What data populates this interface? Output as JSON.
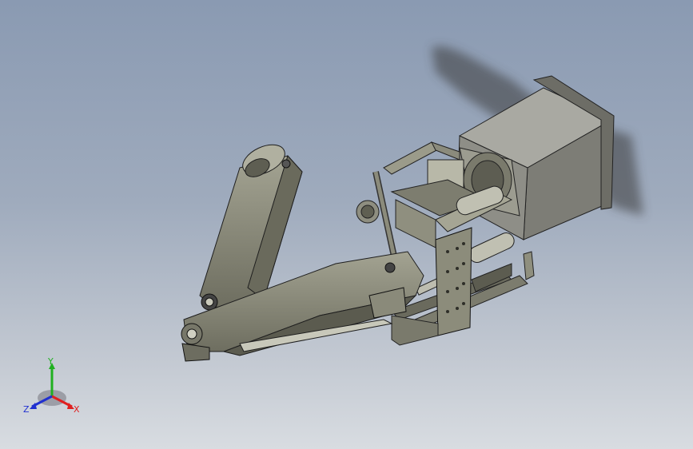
{
  "viewport": {
    "background_top": "#8a9ab2",
    "background_bottom": "#d8dce1"
  },
  "model": {
    "body_color": "#8f8f7e",
    "shade_color": "#5f5f52",
    "edge_color": "#1e1e1e",
    "motor_color": "#8d8d86"
  },
  "triad": {
    "x_label": "X",
    "y_label": "Y",
    "z_label": "Z",
    "x_color": "#e02020",
    "y_color": "#20b020",
    "z_color": "#2030d0"
  }
}
